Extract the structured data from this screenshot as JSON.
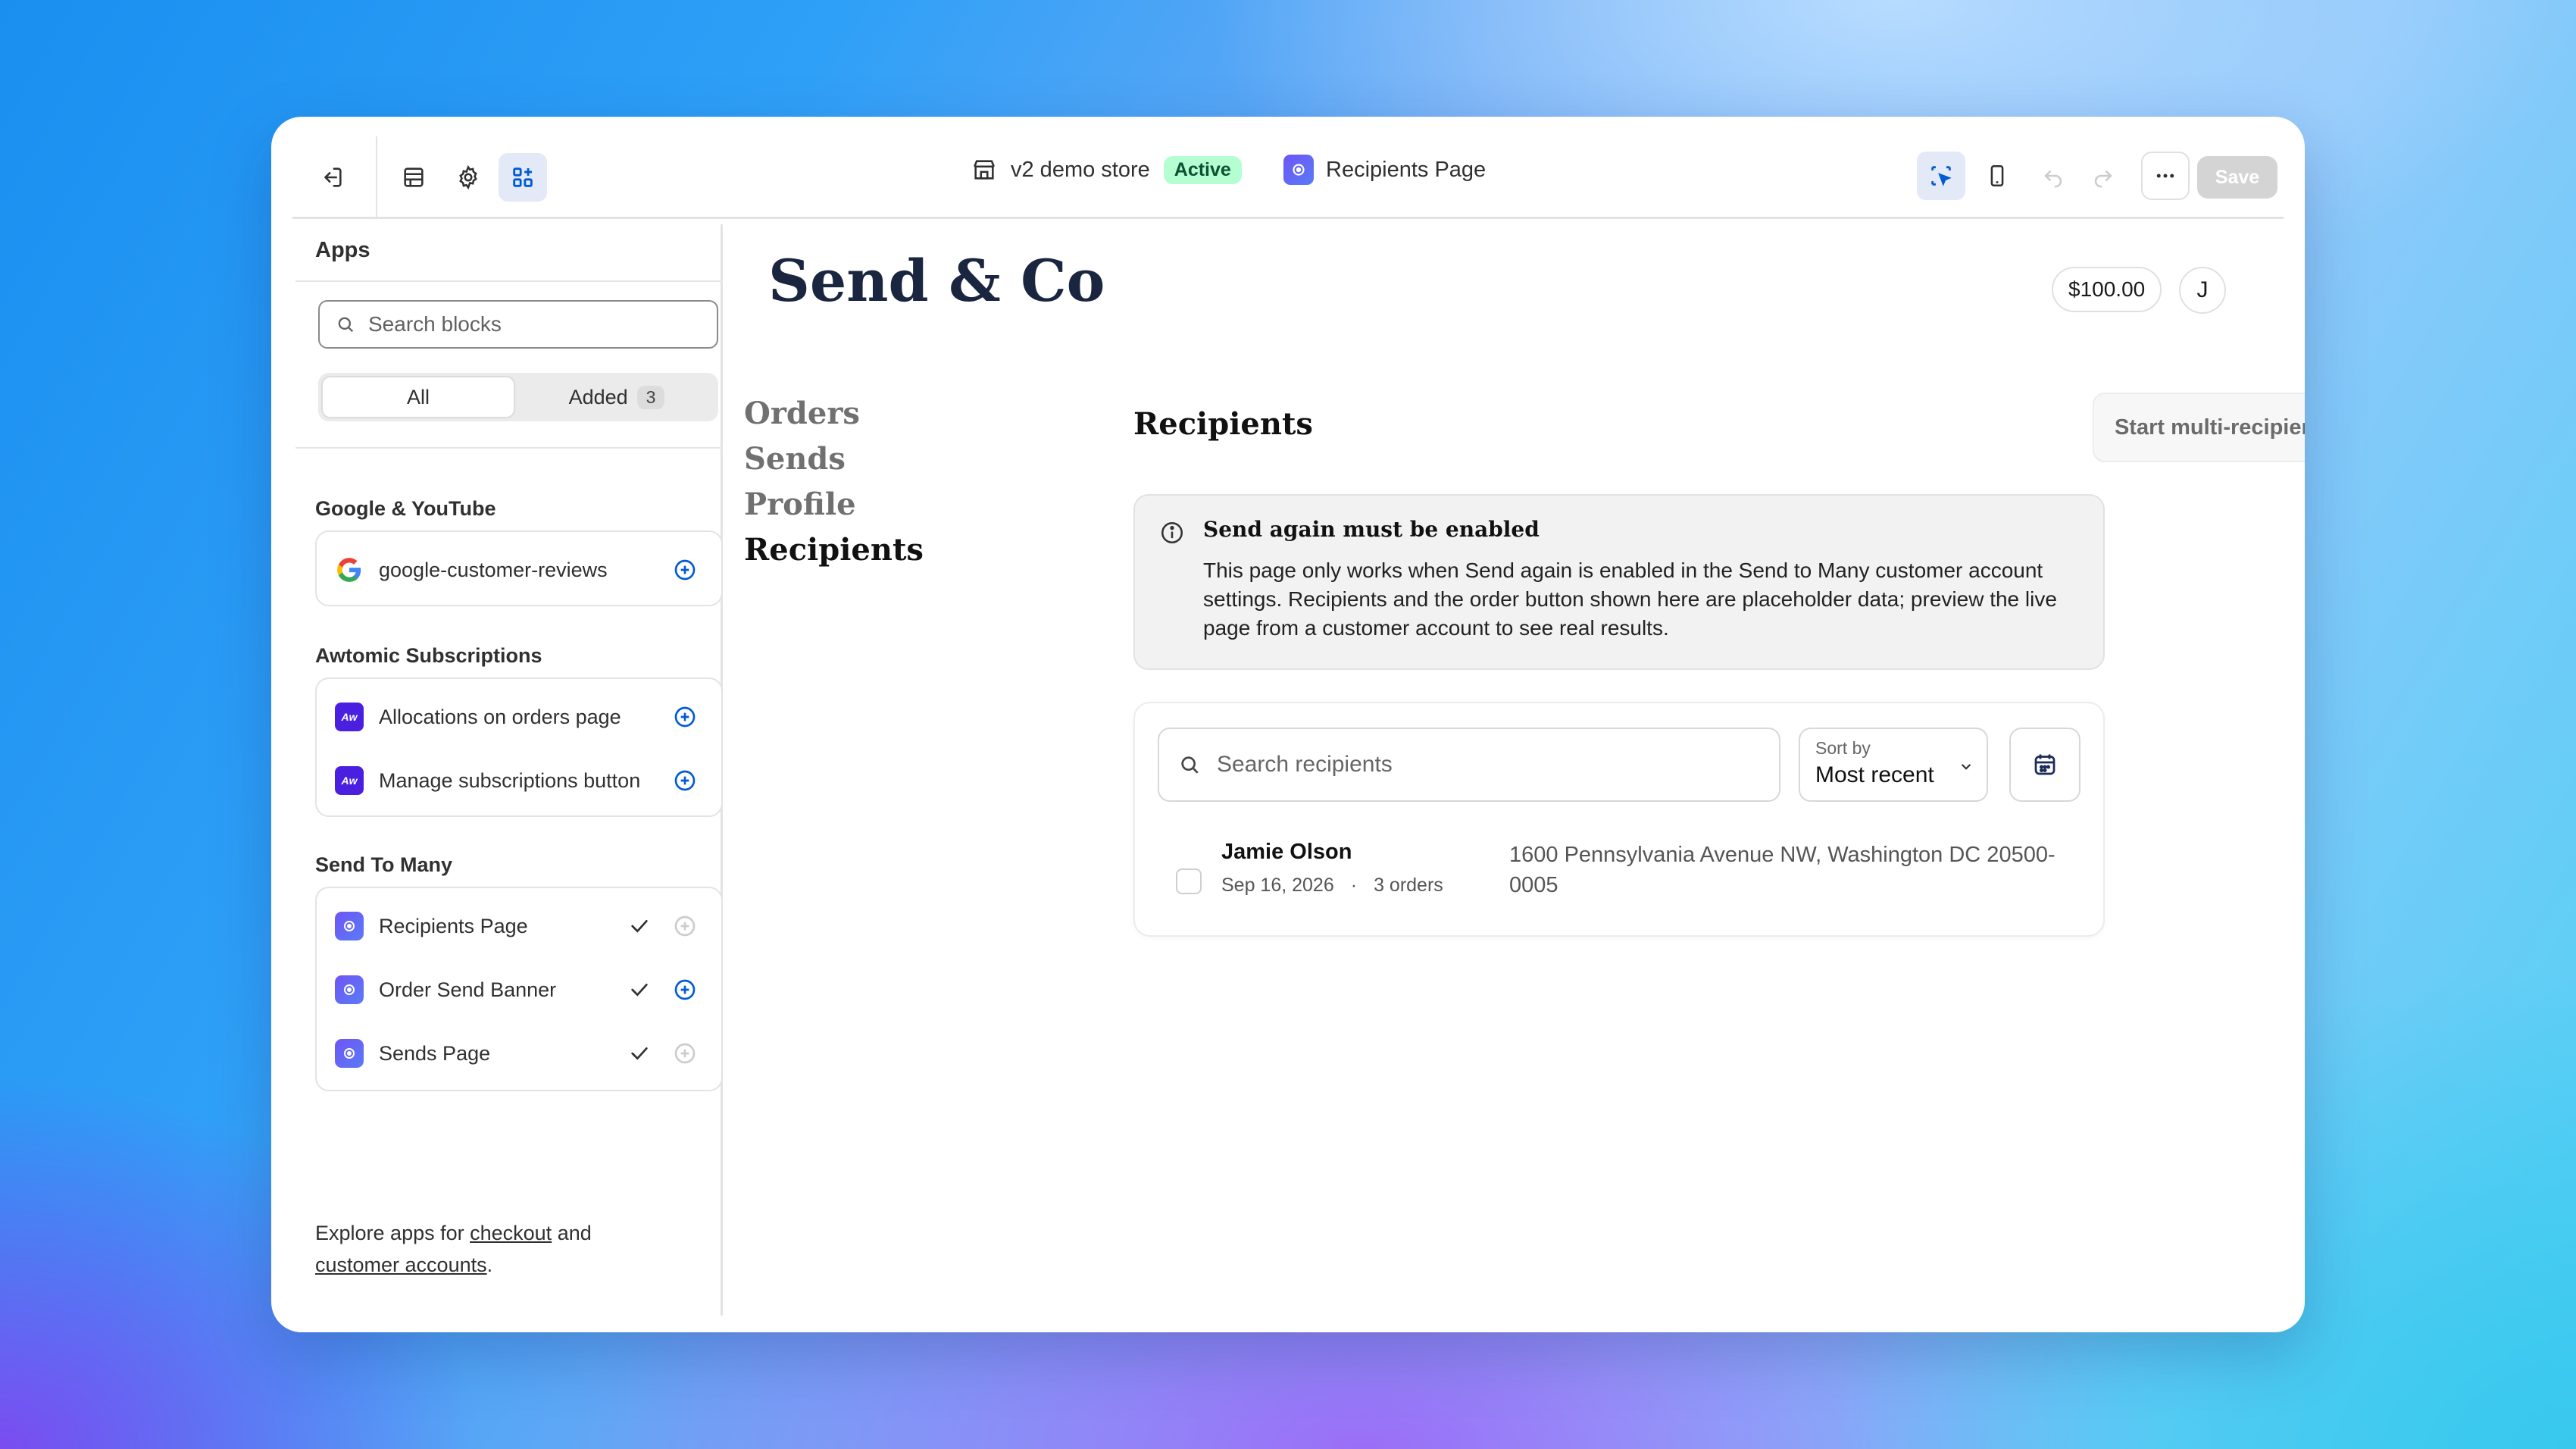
{
  "topbar": {
    "store_name": "v2 demo store",
    "store_status": "Active",
    "page_name": "Recipients Page",
    "save_label": "Save",
    "colors": {
      "active_badge_bg": "#b4fed2",
      "active_badge_text": "#0c5132",
      "selected_tool_bg": "#e3e9f6",
      "accent": "#005bd3"
    }
  },
  "sidebar": {
    "title": "Apps",
    "search_placeholder": "Search blocks",
    "filter_all": "All",
    "filter_added": "Added",
    "added_count": "3",
    "groups": [
      {
        "title": "Google & YouTube",
        "items": [
          {
            "label": "google-customer-reviews",
            "icon": "google-icon",
            "added": false
          }
        ]
      },
      {
        "title": "Awtomic Subscriptions",
        "items": [
          {
            "label": "Allocations on orders page",
            "icon": "awtomic-icon",
            "added": false
          },
          {
            "label": "Manage subscriptions button",
            "icon": "awtomic-icon",
            "added": false
          }
        ]
      },
      {
        "title": "Send To Many",
        "items": [
          {
            "label": "Recipients Page",
            "icon": "send-to-many-icon",
            "added": true
          },
          {
            "label": "Order Send Banner",
            "icon": "send-to-many-icon",
            "added": true
          },
          {
            "label": "Sends Page",
            "icon": "send-to-many-icon",
            "added": true
          }
        ]
      }
    ],
    "explore_prefix": "Explore apps for ",
    "explore_link1": "checkout",
    "explore_mid": " and",
    "explore_link2": "customer accounts",
    "explore_suffix": "."
  },
  "preview": {
    "brand": "Send & Co",
    "balance": "$100.00",
    "avatar_initial": "J",
    "nav": [
      "Orders",
      "Sends",
      "Profile",
      "Recipients"
    ],
    "active_nav": "Recipients",
    "heading": "Recipients",
    "start_button": "Start multi-recipient order",
    "notice_title": "Send again must be enabled",
    "notice_body": "This page only works when Send again is enabled in the Send to Many customer account settings. Recipients and the order button shown here are placeholder data; preview the live page from a customer account to see real results.",
    "search_placeholder": "Search recipients",
    "sort_label": "Sort by",
    "sort_value": "Most recent",
    "recipients": [
      {
        "name": "Jamie Olson",
        "date": "Sep 16, 2026",
        "separator": "·",
        "orders": "3 orders",
        "address": "1600 Pennsylvania Avenue NW, Washington DC 20500-0005"
      }
    ]
  }
}
